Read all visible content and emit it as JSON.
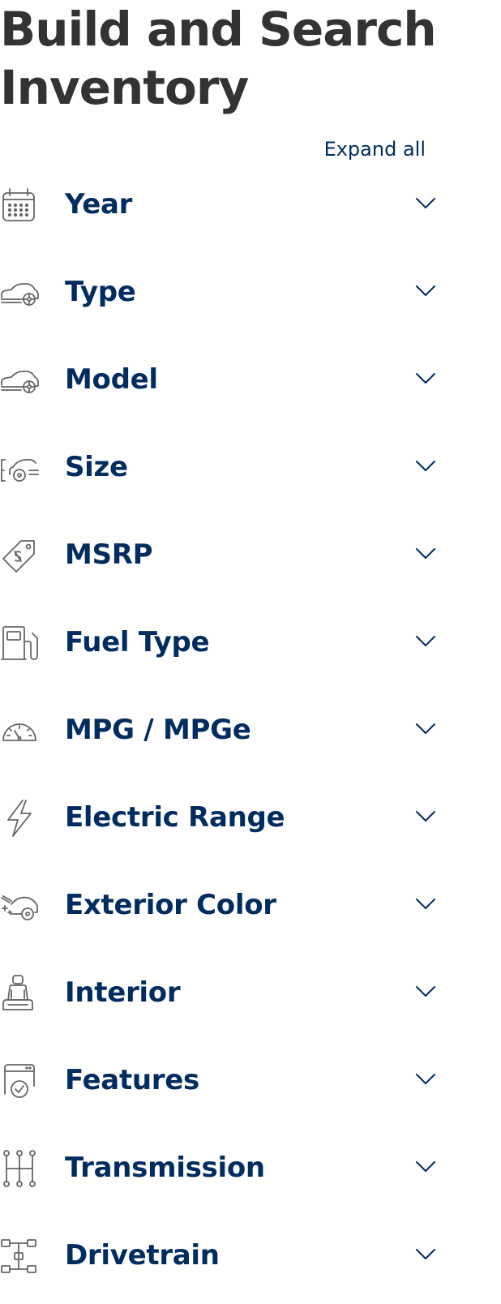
{
  "page": {
    "title": "Build and Search Inventory",
    "expand_all": "Expand all"
  },
  "colors": {
    "brand_navy": "#002c5f",
    "title_gray": "#333333",
    "icon_gray": "#666666"
  },
  "filters": [
    {
      "label": "Year",
      "icon": "calendar-icon"
    },
    {
      "label": "Type",
      "icon": "car-side-icon"
    },
    {
      "label": "Model",
      "icon": "car-side-icon"
    },
    {
      "label": "Size",
      "icon": "car-size-icon"
    },
    {
      "label": "MSRP",
      "icon": "price-tag-icon"
    },
    {
      "label": "Fuel Type",
      "icon": "fuel-pump-icon"
    },
    {
      "label": "MPG / MPGe",
      "icon": "gauge-icon"
    },
    {
      "label": "Electric Range",
      "icon": "lightning-bolt-icon"
    },
    {
      "label": "Exterior Color",
      "icon": "car-sparkle-icon"
    },
    {
      "label": "Interior",
      "icon": "car-seat-icon"
    },
    {
      "label": "Features",
      "icon": "feature-check-icon"
    },
    {
      "label": "Transmission",
      "icon": "gear-shifter-icon"
    },
    {
      "label": "Drivetrain",
      "icon": "drivetrain-icon"
    }
  ]
}
